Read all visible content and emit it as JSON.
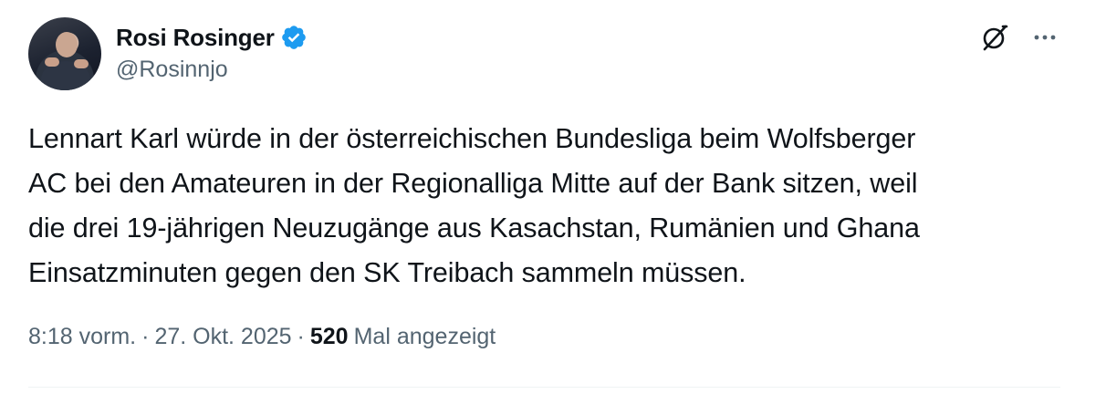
{
  "author": {
    "display_name": "Rosi Rosinger",
    "handle": "@Rosinnjo",
    "verified": true,
    "verified_color": "#1d9bf0"
  },
  "tweet": {
    "text_lines": [
      "Lennart Karl würde in der österreichischen Bundesliga beim Wolfsberger",
      "AC bei den Amateuren in der Regionalliga Mitte auf der Bank sitzen, weil",
      "die drei 19-jährigen Neuzugänge aus Kasachstan, Rumänien und Ghana",
      "Einsatzminuten gegen den SK Treibach sammeln müssen."
    ]
  },
  "meta": {
    "time": "8:18 vorm.",
    "separator": "·",
    "date": "27. Okt. 2025",
    "views_count": "520",
    "views_label": "Mal angezeigt"
  },
  "icons": {
    "grok": "grok-icon",
    "more": "more-icon",
    "verified": "verified-badge-icon"
  },
  "colors": {
    "text": "#0f1419",
    "secondary": "#536471",
    "accent": "#1d9bf0"
  }
}
